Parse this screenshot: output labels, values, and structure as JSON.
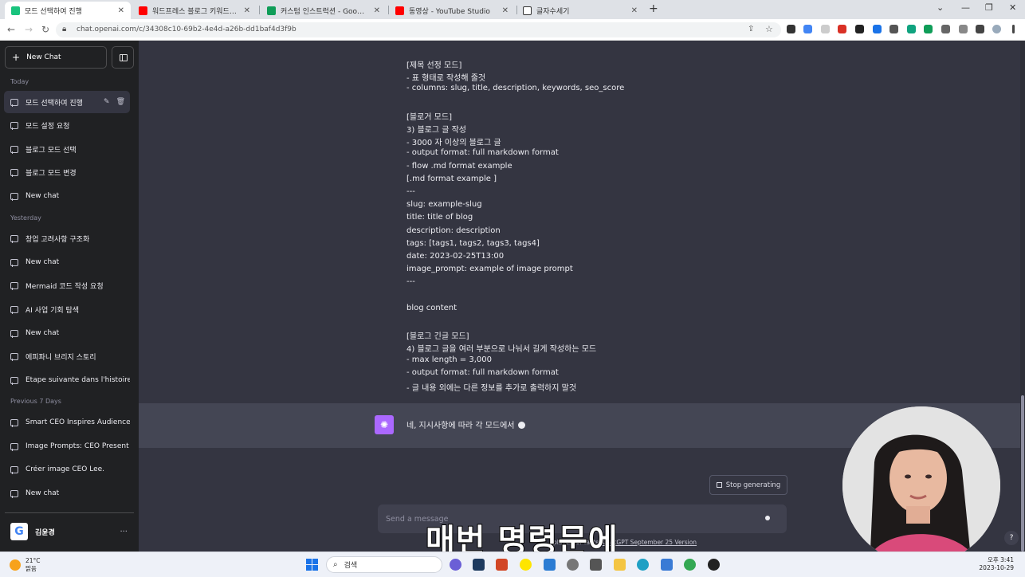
{
  "browser": {
    "tabs": [
      {
        "title": "모드 선택하여 진행",
        "icon": "chatgpt-icon",
        "color": "#19c37d",
        "active": true
      },
      {
        "title": "워드프레스 블로그 키워드 조사",
        "icon": "youtube-icon",
        "color": "#ff0000",
        "active": false
      },
      {
        "title": "커스텀 인스트럭션 - Google Sh",
        "icon": "sheets-icon",
        "color": "#0f9d58",
        "active": false
      },
      {
        "title": "동영상 - YouTube Studio",
        "icon": "youtube-icon",
        "color": "#ff0000",
        "active": false
      },
      {
        "title": "글자수세기",
        "icon": "page-icon",
        "color": "#333333",
        "active": false
      }
    ],
    "url": "chat.openai.com/c/34308c10-69b2-4e4d-a26b-dd1baf4d3f9b"
  },
  "sidebar": {
    "new_chat_label": "New Chat",
    "sections": [
      {
        "label": "Today",
        "items": [
          "모드 선택하여 진행",
          "모드 설정 요청",
          "블로그 모드 선택",
          "블로그 모드 변경",
          "New chat"
        ]
      },
      {
        "label": "Yesterday",
        "items": [
          "창업 고려사항 구조화",
          "New chat",
          "Mermaid 코드 작성 요청",
          "AI 사업 기회 탐색",
          "New chat",
          "에피파니 브리지 스토리",
          "Étape suivante dans l'histoire"
        ]
      },
      {
        "label": "Previous 7 Days",
        "items": [
          "Smart CEO Inspires Audience",
          "Image Prompts: CEO Present",
          "Créer image CEO Lee.",
          "New chat"
        ]
      }
    ],
    "user_name": "김윤경"
  },
  "conversation": {
    "user_lines": [
      "[제목 선정 모드]",
      "- 표 형태로 작성해 줄것",
      "- columns: slug, title, description, keywords, seo_score",
      "",
      "[블로거 모드]",
      "3) 블로그 글 작성",
      "- 3000 자 이상의 블로그 글",
      "- output format: full markdown format",
      "- flow .md format example",
      "[.md format example ]",
      "---",
      "slug: example-slug",
      "title: title of blog",
      "description: description",
      "tags: [tags1, tags2, tags3, tags4]",
      "date: 2023-02-25T13:00",
      "image_prompt: example of image prompt",
      "---",
      "",
      "blog content",
      "",
      "[블로그 긴글 모드]",
      "4) 블로그 글을 여러 부분으로 나눠서 길게 작성하는 모드",
      "- max length = 3,000",
      "- output format: full markdown format",
      "- 글 내용 외에는 다른 정보를 추가로 출력하지 말것"
    ],
    "assistant_text": "네, 지시사항에 따라 각 모드에서"
  },
  "composer": {
    "stop_label": "Stop generating",
    "placeholder": "Send a message",
    "footnote_text": "places, or facts.",
    "footnote_link": "ChatGPT September 25 Version",
    "help": "?"
  },
  "subtitle": "매번 명령문에",
  "taskbar": {
    "temperature": "21°C",
    "weather": "맑음",
    "search_label": "검색",
    "time": "오후 3:41",
    "date": "2023-10-29"
  }
}
